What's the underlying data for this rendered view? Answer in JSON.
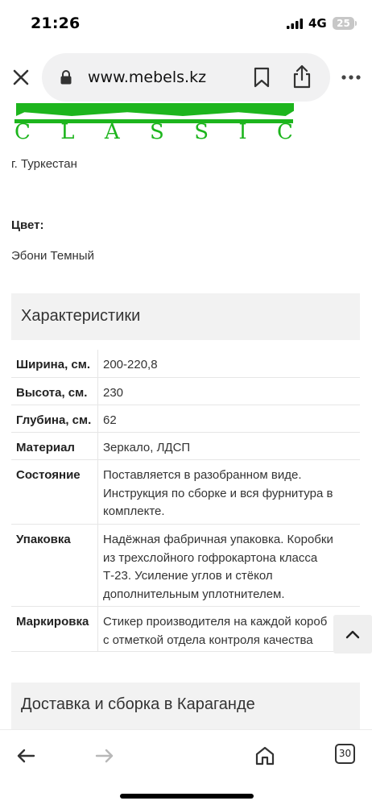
{
  "status": {
    "time": "21:26",
    "network": "4G",
    "battery": "25"
  },
  "browser": {
    "url": "www.mebels.kz",
    "tab_count": "30"
  },
  "logo": {
    "brand_subtitle": [
      "C",
      "L",
      "A",
      "S",
      "S",
      "I",
      "C"
    ],
    "color": "#1db51d"
  },
  "product": {
    "city": "г. Туркестан",
    "color_label": "Цвет:",
    "color_value": "Эбони Темный"
  },
  "characteristics": {
    "title": "Характеристики",
    "rows": [
      {
        "key": "Ширина, см.",
        "value": "200-220,8"
      },
      {
        "key": "Высота, см.",
        "value": "230"
      },
      {
        "key": "Глубина, см.",
        "value": "62"
      },
      {
        "key": "Материал",
        "value": "Зеркало, ЛДСП"
      },
      {
        "key": "Состояние",
        "value": "Поставляется в разобранном виде.\nИнструкция по сборке и вся фурнитура в\nкомплекте."
      },
      {
        "key": "Упаковка",
        "value": "Надёжная фабричная упаковка. Коробки\nиз трехслойного гофрокартона класса\nТ-23. Усиление углов и стёкол\nдополнительным уплотнителем."
      },
      {
        "key": "Маркировка",
        "value": "Стикер производителя на каждой короб\nс отметкой отдела контроля качества"
      }
    ]
  },
  "delivery": {
    "title": "Доставка и сборка в Караганде"
  }
}
